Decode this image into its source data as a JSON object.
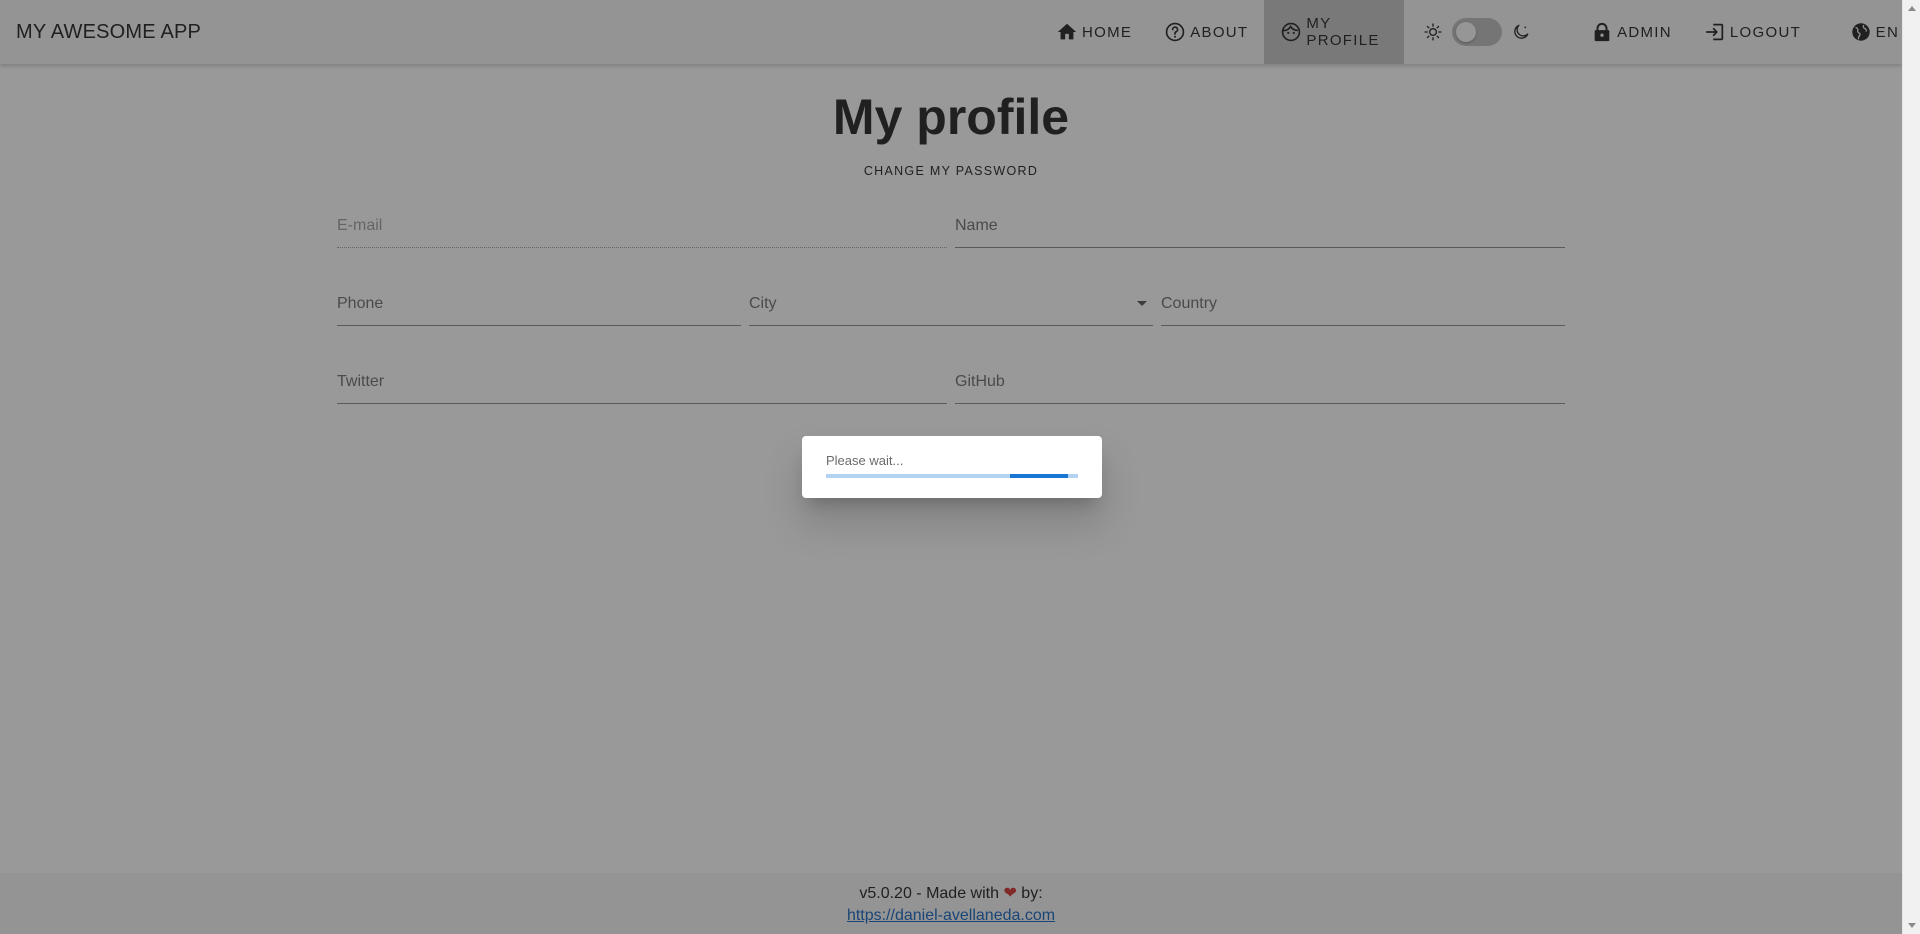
{
  "app": {
    "title": "MY AWESOME APP"
  },
  "nav": {
    "home": "HOME",
    "about": "ABOUT",
    "my_profile": "MY PROFILE",
    "admin": "ADMIN",
    "logout": "LOGOUT",
    "language": "EN",
    "active": "my_profile",
    "dark_mode": false
  },
  "main": {
    "title": "My profile",
    "change_password_label": "CHANGE MY PASSWORD",
    "fields": {
      "email": {
        "placeholder": "E-mail",
        "value": "",
        "disabled": true
      },
      "name": {
        "placeholder": "Name",
        "value": ""
      },
      "phone": {
        "placeholder": "Phone",
        "value": ""
      },
      "city": {
        "placeholder": "City",
        "value": ""
      },
      "country": {
        "placeholder": "Country",
        "value": ""
      },
      "twitter": {
        "placeholder": "Twitter",
        "value": ""
      },
      "github": {
        "placeholder": "GitHub",
        "value": ""
      }
    }
  },
  "dialog": {
    "message": "Please wait...",
    "progress_indeterminate": true
  },
  "footer": {
    "version_text": "v5.0.20 - Made with",
    "heart": "❤",
    "by_text": "by:",
    "link_text": "https://daniel-avellaneda.com"
  },
  "colors": {
    "primary": "#1976d2",
    "progress_track": "#b3d4f1",
    "heart": "#d32f2f",
    "link": "#1565c0",
    "appbar": "#f5f5f5",
    "active_nav": "#c4c4c4"
  },
  "icons": {
    "home": "home-icon",
    "about": "help-circle-icon",
    "my_profile": "face-icon",
    "light_mode": "sun-icon",
    "dark_mode": "moon-icon",
    "admin": "lock-icon",
    "logout": "login-icon",
    "language": "globe-icon"
  }
}
